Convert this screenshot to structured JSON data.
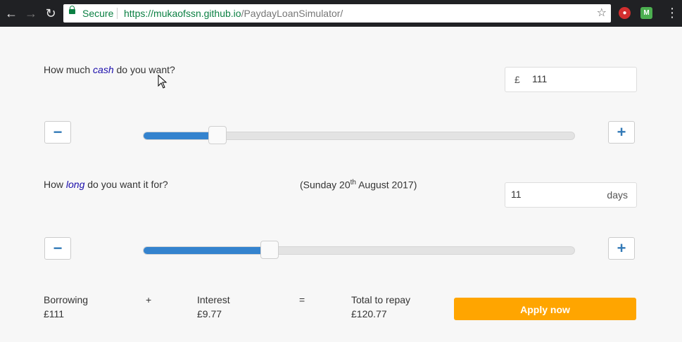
{
  "browser": {
    "secure_label": "Secure",
    "url_scheme": "https://",
    "url_host": "mukaofssn.github.io",
    "url_path": "/PaydayLoanSimulator/"
  },
  "cash": {
    "question_pre": "How much ",
    "question_em": "cash",
    "question_post": " do you want?",
    "currency": "£",
    "value": "111",
    "minus": "−",
    "plus": "+",
    "slider_fraction": 0.172
  },
  "duration": {
    "question_pre": "How ",
    "question_em": "long",
    "question_post": " do you want it for?",
    "date_pre": "(Sunday 20",
    "date_sup": "th",
    "date_post": " August 2017)",
    "value": "11",
    "unit": "days",
    "minus": "−",
    "plus": "+",
    "slider_fraction": 0.293
  },
  "summary": {
    "borrowing_label": "Borrowing",
    "borrowing_value": "£111",
    "plus_sign": "+",
    "interest_label": "Interest",
    "interest_value": "£9.77",
    "equals_sign": "=",
    "total_label": "Total to repay",
    "total_value": "£120.77"
  },
  "apply_label": "Apply now",
  "icons": [
    "back-arrow-icon",
    "forward-arrow-icon",
    "reload-icon",
    "lock-icon",
    "star-icon",
    "menu-dots-icon",
    "mouse-cursor-icon"
  ]
}
